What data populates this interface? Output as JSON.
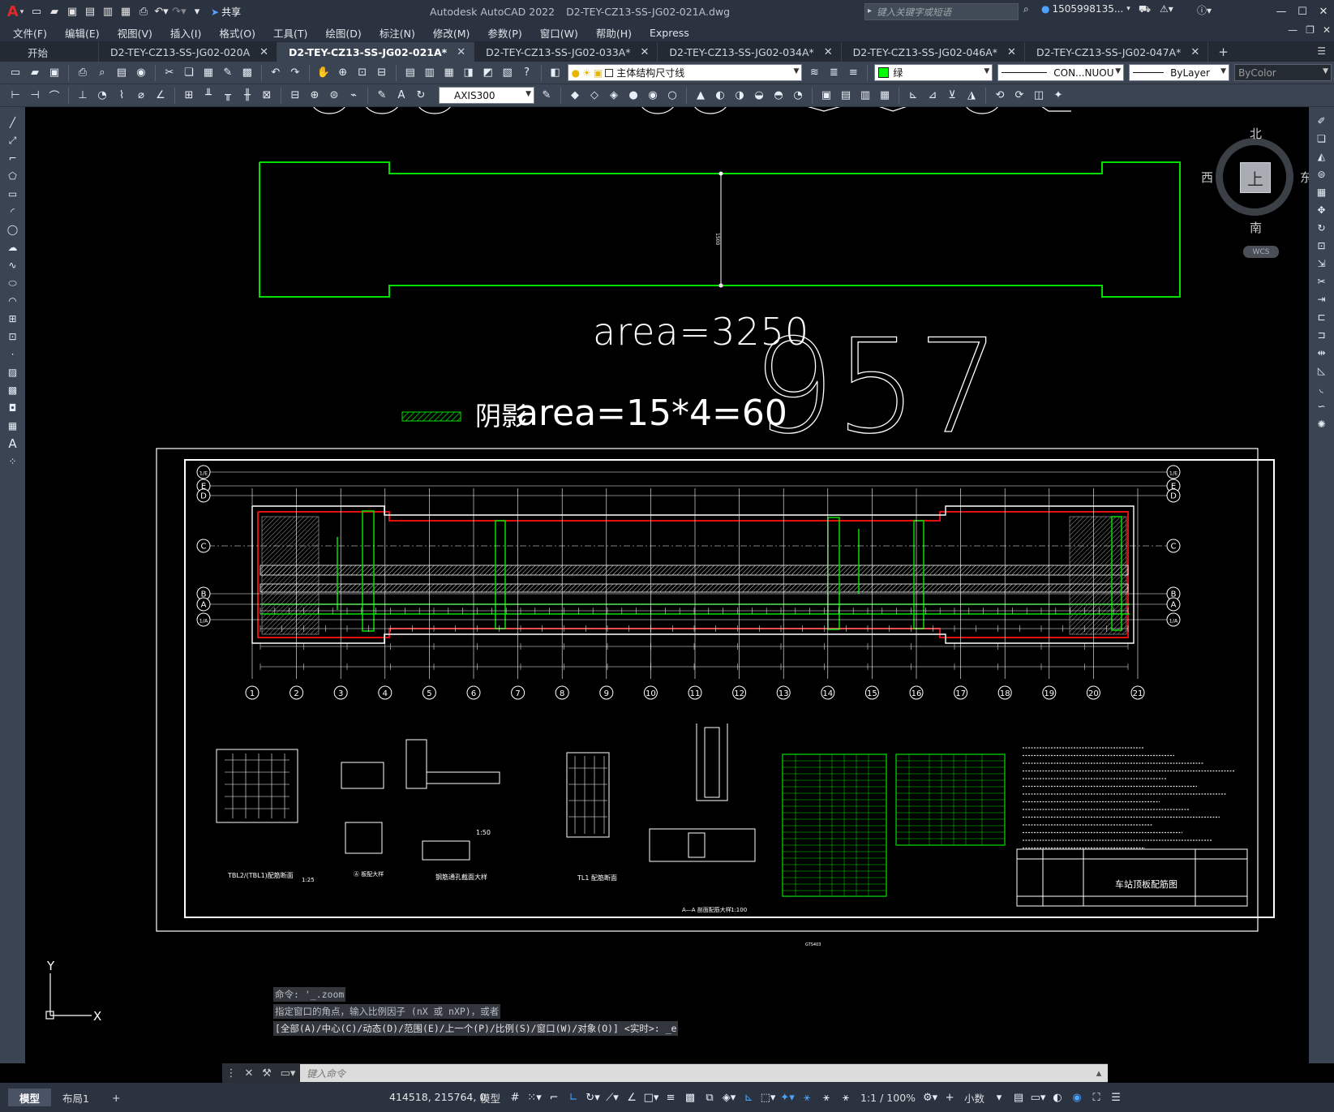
{
  "app": {
    "product": "Autodesk AutoCAD 2022",
    "file": "D2-TEY-CZ13-SS-JG02-021A.dwg",
    "search_placeholder": "键入关键字或短语",
    "user": "1505998135...",
    "share": "共享"
  },
  "menu": [
    "文件(F)",
    "编辑(E)",
    "视图(V)",
    "插入(I)",
    "格式(O)",
    "工具(T)",
    "绘图(D)",
    "标注(N)",
    "修改(M)",
    "参数(P)",
    "窗口(W)",
    "帮助(H)",
    "Express"
  ],
  "tabs": [
    {
      "label": "开始",
      "active": false
    },
    {
      "label": "D2-TEY-CZ13-SS-JG02-020A",
      "active": false
    },
    {
      "label": "D2-TEY-CZ13-SS-JG02-021A*",
      "active": true
    },
    {
      "label": "D2-TEY-CZ13-SS-JG02-033A*",
      "active": false
    },
    {
      "label": "D2-TEY-CZ13-SS-JG02-034A*",
      "active": false
    },
    {
      "label": "D2-TEY-CZ13-SS-JG02-046A*",
      "active": false
    },
    {
      "label": "D2-TEY-CZ13-SS-JG02-047A*",
      "active": false
    }
  ],
  "toolbar": {
    "layer": "主体结构尺寸线",
    "color": "绿",
    "color_hex": "#00ff00",
    "linetype": "CON...NUOU",
    "lineweight": "ByLayer",
    "plotstyle": "ByColor",
    "dimstyle": "AXIS300"
  },
  "drawing": {
    "area_label": "area=3250",
    "hatch_label_cn": "阴影",
    "hatch_label": "area=15*4=60",
    "big_number": "957",
    "axis_numbers": [
      "1",
      "2",
      "3",
      "4",
      "5",
      "6",
      "7",
      "8",
      "9",
      "10",
      "11",
      "12",
      "13",
      "14",
      "15",
      "16",
      "17",
      "18",
      "19",
      "20",
      "21"
    ],
    "row_labels_left": [
      "1/E",
      "E",
      "D",
      "C",
      "B",
      "A",
      "1/A"
    ],
    "title_block": "车站顶板配筋图",
    "detail_labels": [
      "TBL2/(TBL1)配筋断面",
      "Ⓐ 板配大样",
      "钢筋通孔截面大样",
      "TL1 配筋断面",
      "A—A 剖面配筋大样"
    ],
    "scales": [
      "1:25",
      "1:50",
      "1:100"
    ]
  },
  "viewcube": {
    "north": "北",
    "south": "南",
    "east": "东",
    "west": "西",
    "face": "上",
    "wcs": "WCS"
  },
  "ucs": {
    "x": "X",
    "y": "Y"
  },
  "command_history": [
    "命令: '_.zoom",
    "指定窗口的角点，输入比例因子 (nX 或 nXP)，或者",
    "[全部(A)/中心(C)/动态(D)/范围(E)/上一个(P)/比例(S)/窗口(W)/对象(O)] <实时>: _e"
  ],
  "command_placeholder": "键入命令",
  "status": {
    "layouts": [
      "模型",
      "布局1"
    ],
    "coords": "414518, 215764, 0",
    "space": "模型",
    "scale": "1:1 / 100%",
    "units": "小数"
  }
}
